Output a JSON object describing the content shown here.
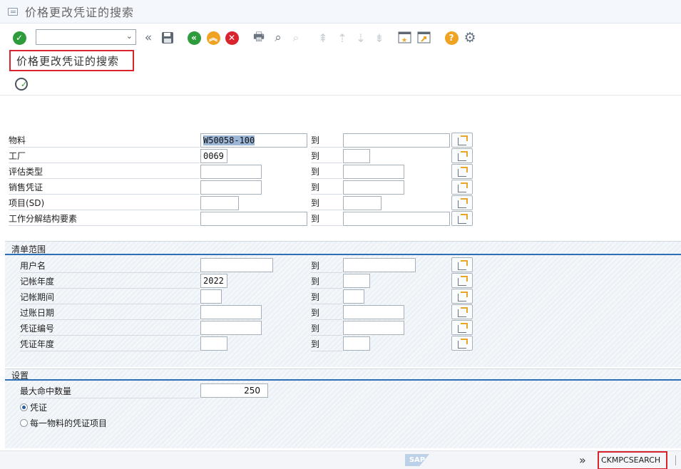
{
  "window": {
    "title": "价格更改凭证的搜索"
  },
  "toolbar": {
    "command_placeholder": "",
    "colors": {
      "green": "#2e9c3c",
      "orange": "#f0a323",
      "red": "#d9232d",
      "help": "#f0a323"
    }
  },
  "screen_title": "价格更改凭证的搜索",
  "to_label": "到",
  "selection": {
    "rows": [
      {
        "label": "物料",
        "from": "W50058-100",
        "to": ""
      },
      {
        "label": "工厂",
        "from": "0069",
        "to": ""
      },
      {
        "label": "评估类型",
        "from": "",
        "to": ""
      },
      {
        "label": "销售凭证",
        "from": "",
        "to": ""
      },
      {
        "label": "项目(SD)",
        "from": "",
        "to": ""
      },
      {
        "label": "工作分解结构要素",
        "from": "",
        "to": ""
      }
    ]
  },
  "list_scope": {
    "title": "清单范围",
    "rows": [
      {
        "label": "用户名",
        "from": "",
        "to": ""
      },
      {
        "label": "记帐年度",
        "from": "2022",
        "to": ""
      },
      {
        "label": "记帐期间",
        "from": "",
        "to": ""
      },
      {
        "label": "过账日期",
        "from": "",
        "to": ""
      },
      {
        "label": "凭证编号",
        "from": "",
        "to": ""
      },
      {
        "label": "凭证年度",
        "from": "",
        "to": ""
      }
    ]
  },
  "settings": {
    "title": "设置",
    "max_hits_label": "最大命中数量",
    "max_hits_value": "250",
    "radio_1": "凭证",
    "radio_2": "每一物料的凭证项目",
    "selected": "radio_1"
  },
  "statusbar": {
    "sap_logo": "SAP",
    "tcode": "CKMPCSEARCH"
  }
}
